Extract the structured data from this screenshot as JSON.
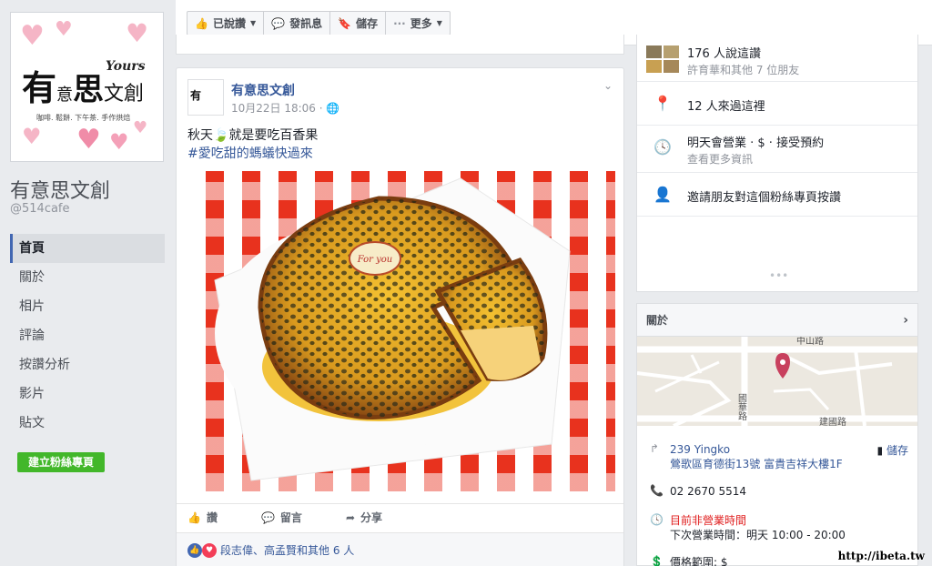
{
  "page": {
    "name": "有意思文創",
    "handle": "@514cafe",
    "logo": {
      "yours": "Yours",
      "you": "有",
      "yi": "意",
      "si": "思",
      "wenchuang": "文創",
      "tagline": "咖啡. 鬆餅. 下午茶. 手作烘焙"
    },
    "nav": [
      {
        "label": "首頁",
        "active": true
      },
      {
        "label": "關於"
      },
      {
        "label": "相片"
      },
      {
        "label": "評論"
      },
      {
        "label": "按讚分析"
      },
      {
        "label": "影片"
      },
      {
        "label": "貼文"
      }
    ],
    "create_button": "建立粉絲專頁"
  },
  "action_bar": {
    "liked": "已說讚",
    "message": "發訊息",
    "save": "儲存",
    "more": "更多"
  },
  "post": {
    "author": "有意思文創",
    "time": "10月22日 18:06 · ",
    "text_line1": "秋天",
    "text_line1_rest": "就是要吃百香果",
    "hashtag": "#愛吃甜的螞蟻快過來",
    "cake_plaque": "For you",
    "actions": {
      "like": "讚",
      "comment": "留言",
      "share": "分享"
    },
    "likes_text": "段志偉、高孟賢和其他 6 人"
  },
  "sidebar": {
    "likes_main": "176 人說這讚",
    "likes_sub": "許育華和其他 7 位朋友",
    "visits": "12 人來過這裡",
    "hours_main": "明天會營業 · $ · 接受預約",
    "hours_sub": "查看更多資訊",
    "invite": "邀請朋友對這個粉絲專頁按讚"
  },
  "about": {
    "title": "關於",
    "map_labels": {
      "road1": "中山路",
      "road2": "國華路",
      "road3": "建國路"
    },
    "address_line1": "239 Yingko",
    "address_line2": "鶯歌區育德街13號 富貴吉祥大樓1F",
    "save": "儲存",
    "phone": "02 2670 5514",
    "status": "目前非營業時間",
    "next_hours": "下次營業時間：明天 10:00 - 20:00",
    "price": "價格範圍: $"
  },
  "watermark": "http://ibeta.tw",
  "colors": {
    "fb_blue": "#4267b2",
    "link_blue": "#365899",
    "green": "#42b72a",
    "red_text": "#e02020"
  }
}
